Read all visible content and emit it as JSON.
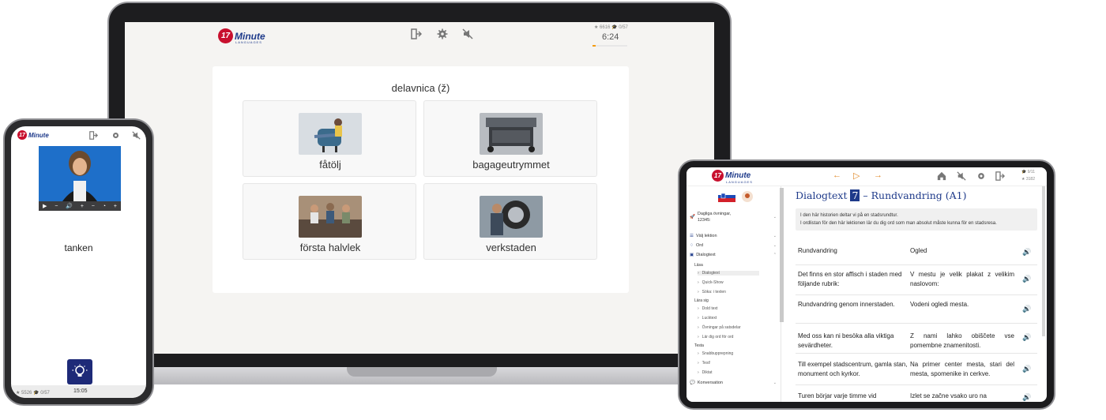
{
  "laptop": {
    "logo": {
      "badge": "17",
      "text": "Minute",
      "sub": "LANGUAGES"
    },
    "icons": [
      "exit-icon",
      "settings-icon",
      "mute-icon"
    ],
    "stats": "★ 6616 🎓 0/57",
    "timer": "6:24",
    "progress_fraction": 0.1,
    "quiz": {
      "word": "delavnica (ž)",
      "choices": [
        {
          "label": "fåtölj",
          "image": "woman-in-armchair"
        },
        {
          "label": "bagageutrymmet",
          "image": "car-trunk"
        },
        {
          "label": "första halvlek",
          "image": "friends-on-couch"
        },
        {
          "label": "verkstaden",
          "image": "mechanic-with-tire"
        }
      ]
    }
  },
  "phone": {
    "logo": {
      "badge": "17",
      "text": "Minute"
    },
    "video_controls": [
      "▶",
      "−",
      "🔊",
      "+",
      "−",
      "◔",
      "+"
    ],
    "word": "tanken",
    "footer": {
      "stats": "★ 5526 🎓 0/57",
      "timer": "15:05"
    }
  },
  "tablet": {
    "logo": {
      "badge": "17",
      "text": "Minute",
      "sub": "LANGUAGES"
    },
    "nav": {
      "prev": "←",
      "play": "▷",
      "next": "→"
    },
    "stats": {
      "top": "🎓 9/11",
      "bottom": "★ 3182"
    },
    "sidebar": {
      "top_item": {
        "label": "Dagliga övningar,",
        "sub": "12345:"
      },
      "items": [
        {
          "label": "Välj lektion"
        },
        {
          "label": "Ord"
        },
        {
          "label": "Dialogtext"
        }
      ],
      "sections": [
        {
          "title": "Läsa",
          "leaves": [
            "Dialogtext",
            "Quick-Show",
            "Söka: i texten"
          ]
        },
        {
          "title": "Lära sig",
          "leaves": [
            "Dold text",
            "Lucktext",
            "Övningar på satsdelar",
            "Lär dig ord för ord"
          ]
        },
        {
          "title": "Testa",
          "leaves": [
            "Snabbupprepning",
            "Test!",
            "Diktat"
          ]
        }
      ],
      "bottom_item": "Konversation"
    },
    "title": {
      "prefix": "Dialogtext",
      "number": "7",
      "suffix": "– Rundvandring (A1)"
    },
    "intro": {
      "line1": "I den här historien deltar vi på en stadsrundtur.",
      "line2": "I ordlistan för den här lektionen lär du dig ord som man absolut måste kunna för en stadsresa."
    },
    "dialog": [
      {
        "sv": "Rundvandring",
        "sl": "Ogled"
      },
      {
        "sv": "Det finns en stor affisch i staden med följande rubrik:",
        "sl": "V mestu je velik plakat z velikim naslovom:"
      },
      {
        "sv": "Rundvandring genom innerstaden.",
        "sl": "Vodeni ogledi mesta."
      },
      {
        "sv": "Med oss kan ni besöka alla viktiga sevärdheter.",
        "sl": "Z nami lahko obiščete vse pomembne znamenitosti."
      },
      {
        "sv": "Till exempel stadscentrum, gamla stan, monument och kyrkor.",
        "sl": "Na primer center mesta, stari del mesta, spomenike in cerkve."
      },
      {
        "sv": "Turen börjar varje timme vid",
        "sl": "Izlet se začne vsako uro na"
      }
    ]
  },
  "colors": {
    "brand_blue": "#1e3a8a",
    "brand_red": "#c8102e",
    "accent_orange": "#f39c12"
  }
}
